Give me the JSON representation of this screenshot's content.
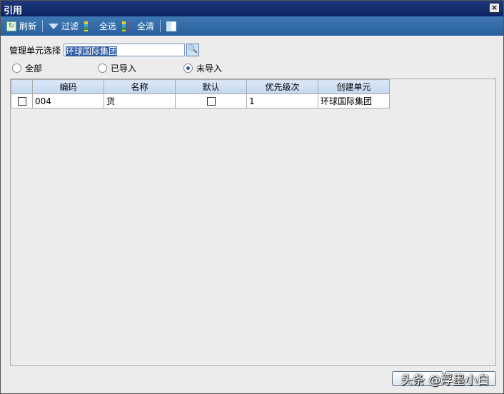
{
  "window": {
    "title": "引用",
    "close": "×"
  },
  "toolbar": {
    "refresh": "刷新",
    "filter": "过滤",
    "select_all": "全选",
    "clear_all": "全清"
  },
  "org": {
    "label": "管理单元选择",
    "value": "环球国际集团"
  },
  "radios": [
    {
      "label": "全部",
      "checked": false
    },
    {
      "label": "已导入",
      "checked": false
    },
    {
      "label": "未导入",
      "checked": true
    }
  ],
  "table": {
    "headers": [
      "编码",
      "名称",
      "默认",
      "优先级次",
      "创建单元"
    ],
    "rows": [
      {
        "checked": false,
        "code": "004",
        "name": "货",
        "default": false,
        "priority": "1",
        "unit": "环球国际集团"
      }
    ]
  },
  "watermark": "头条 @浮墨小白"
}
